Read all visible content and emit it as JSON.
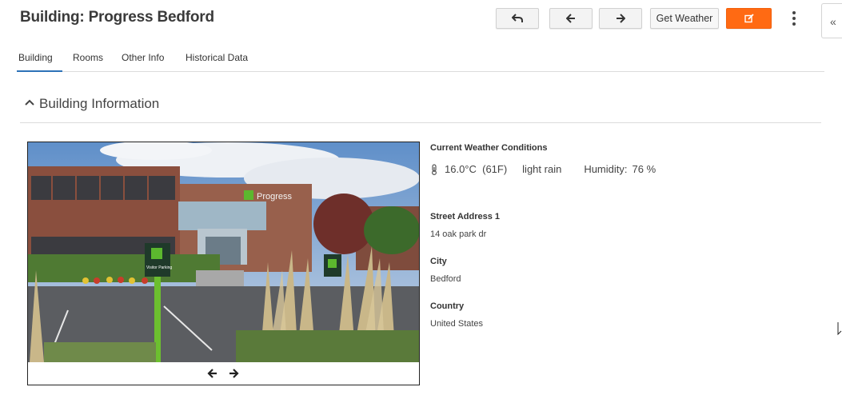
{
  "page": {
    "title": "Building: Progress Bedford"
  },
  "toolbar": {
    "undo_icon": "undo-arrow-icon",
    "prev_icon": "arrow-left-icon",
    "next_icon": "arrow-right-icon",
    "weather_label": "Get Weather",
    "edit_icon": "edit-icon",
    "edit_color": "#ff6a13",
    "more_icon": "kebab-menu-icon"
  },
  "side_toggle": {
    "label": "«"
  },
  "tabs": [
    {
      "label": "Building",
      "active": true
    },
    {
      "label": "Rooms",
      "active": false
    },
    {
      "label": "Other Info",
      "active": false
    },
    {
      "label": "Historical Data",
      "active": false
    }
  ],
  "section": {
    "title": "Building Information",
    "icon": "chevron-up-icon"
  },
  "image_carousel": {
    "prev_icon": "arrow-left-icon",
    "next_icon": "arrow-right-icon",
    "sign_text": "Progress",
    "visitor_sign": "Visitor Parking"
  },
  "weather": {
    "heading": "Current Weather Conditions",
    "icon": "thermometer-icon",
    "temperature": "16.0°C  (61F)",
    "condition": "light rain",
    "humidity_label": "Humidity:",
    "humidity_value": "76 %"
  },
  "address": {
    "street_label": "Street Address 1",
    "street_value": "14 oak park dr",
    "city_label": "City",
    "city_value": "Bedford",
    "country_label": "Country",
    "country_value": "United States"
  },
  "colors": {
    "accent": "#2d72b8",
    "brand_green": "#5cb82e"
  }
}
